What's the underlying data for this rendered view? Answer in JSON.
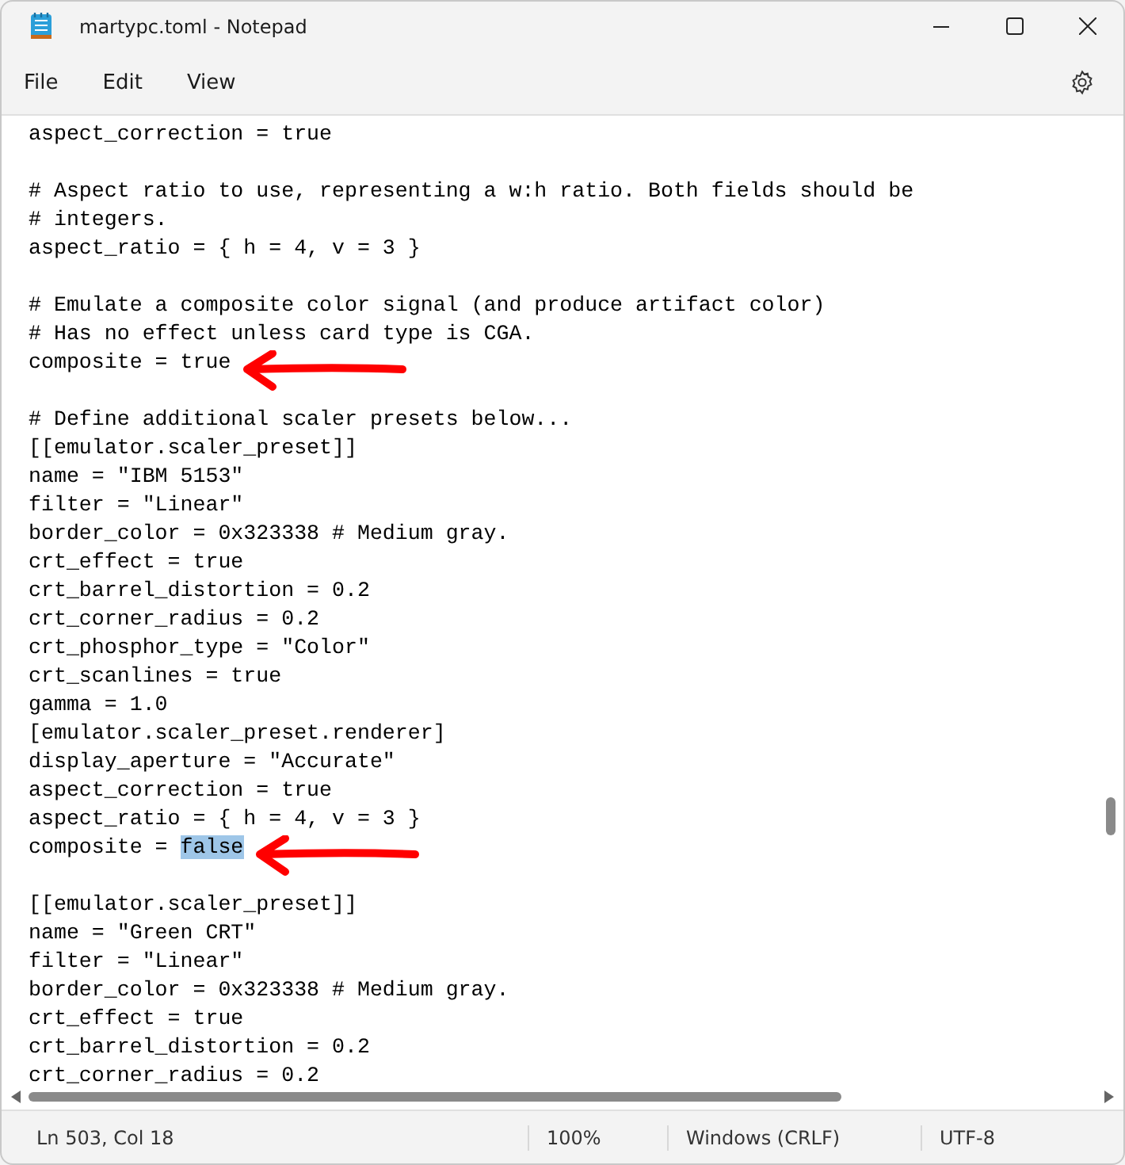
{
  "window": {
    "title": "martypc.toml - Notepad"
  },
  "menu": [
    "File",
    "Edit",
    "View"
  ],
  "editor": {
    "lines": [
      {
        "kind": "code",
        "text": "aspect_correction = true",
        "annotated": false
      },
      {
        "kind": "blank"
      },
      {
        "kind": "code",
        "text": "# Aspect ratio to use, representing a w:h ratio. Both fields should be",
        "annotated": false
      },
      {
        "kind": "code",
        "text": "# integers.",
        "annotated": false
      },
      {
        "kind": "code",
        "text": "aspect_ratio = { h = 4, v = 3 }",
        "annotated": false
      },
      {
        "kind": "blank"
      },
      {
        "kind": "code",
        "text": "# Emulate a composite color signal (and produce artifact color)",
        "annotated": false
      },
      {
        "kind": "code",
        "text": "# Has no effect unless card type is CGA.",
        "annotated": false
      },
      {
        "kind": "code",
        "text": "composite = true",
        "annotated": true
      },
      {
        "kind": "blank"
      },
      {
        "kind": "code",
        "text": "# Define additional scaler presets below...",
        "annotated": false
      },
      {
        "kind": "code",
        "text": "[[emulator.scaler_preset]]",
        "annotated": false
      },
      {
        "kind": "code",
        "text": "name = \"IBM 5153\"",
        "annotated": false
      },
      {
        "kind": "code",
        "text": "filter = \"Linear\"",
        "annotated": false
      },
      {
        "kind": "code",
        "text": "border_color = 0x323338 # Medium gray.",
        "annotated": false
      },
      {
        "kind": "code",
        "text": "crt_effect = true",
        "annotated": false
      },
      {
        "kind": "code",
        "text": "crt_barrel_distortion = 0.2",
        "annotated": false
      },
      {
        "kind": "code",
        "text": "crt_corner_radius = 0.2",
        "annotated": false
      },
      {
        "kind": "code",
        "text": "crt_phosphor_type = \"Color\"",
        "annotated": false
      },
      {
        "kind": "code",
        "text": "crt_scanlines = true",
        "annotated": false
      },
      {
        "kind": "code",
        "text": "gamma = 1.0",
        "annotated": false
      },
      {
        "kind": "code",
        "text": "[emulator.scaler_preset.renderer]",
        "annotated": false
      },
      {
        "kind": "code",
        "text": "display_aperture = \"Accurate\"",
        "annotated": false
      },
      {
        "kind": "code",
        "text": "aspect_correction = true",
        "annotated": false
      },
      {
        "kind": "code",
        "text": "aspect_ratio = { h = 4, v = 3 }",
        "annotated": false
      },
      {
        "kind": "code",
        "text": "composite = ",
        "selection": "false",
        "annotated": true
      },
      {
        "kind": "blank"
      },
      {
        "kind": "code",
        "text": "[[emulator.scaler_preset]]",
        "annotated": false
      },
      {
        "kind": "code",
        "text": "name = \"Green CRT\"",
        "annotated": false
      },
      {
        "kind": "code",
        "text": "filter = \"Linear\"",
        "annotated": false
      },
      {
        "kind": "code",
        "text": "border_color = 0x323338 # Medium gray.",
        "annotated": false
      },
      {
        "kind": "code",
        "text": "crt_effect = true",
        "annotated": false
      },
      {
        "kind": "code",
        "text": "crt_barrel_distortion = 0.2",
        "annotated": false
      },
      {
        "kind": "code",
        "text": "crt_corner_radius = 0.2",
        "annotated": false
      }
    ]
  },
  "status_bar": [
    "Ln 503, Col 18",
    "100%",
    "Windows (CRLF)",
    "UTF-8"
  ]
}
